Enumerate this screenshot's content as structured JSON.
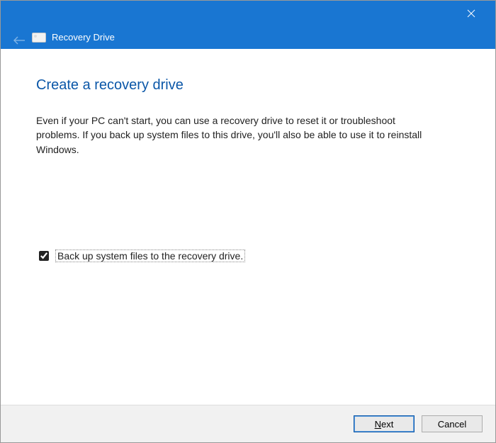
{
  "titlebar": {
    "app_title": "Recovery Drive"
  },
  "main": {
    "heading": "Create a recovery drive",
    "body": "Even if your PC can't start, you can use a recovery drive to reset it or troubleshoot problems. If you back up system files to this drive, you'll also be able to use it to reinstall Windows."
  },
  "option": {
    "checked": true,
    "label": "Back up system files to the recovery drive."
  },
  "footer": {
    "next_mn": "N",
    "next_rest": "ext",
    "cancel": "Cancel"
  }
}
